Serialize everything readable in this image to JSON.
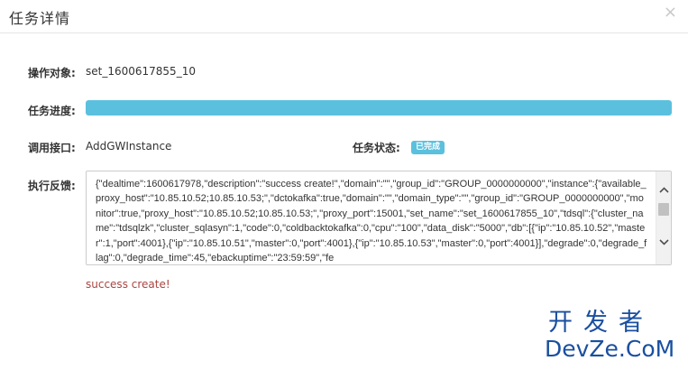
{
  "dialog": {
    "title": "任务详情",
    "close_symbol": "×"
  },
  "fields": {
    "target_label": "操作对象:",
    "target_value": "set_1600617855_10",
    "progress_label": "任务进度:",
    "progress_percent": 100,
    "interface_label": "调用接口:",
    "interface_value": "AddGWInstance",
    "status_label": "任务状态:",
    "status_value": "已完成",
    "feedback_label": "执行反馈:"
  },
  "feedback": {
    "text": "{\"dealtime\":1600617978,\"description\":\"success create!\",\"domain\":\"\",\"group_id\":\"GROUP_0000000000\",\"instance\":{\"available_proxy_host\":\"10.85.10.52;10.85.10.53;\",\"dctokafka\":true,\"domain\":\"\",\"domain_type\":\"\",\"group_id\":\"GROUP_0000000000\",\"monitor\":true,\"proxy_host\":\"10.85.10.52;10.85.10.53;\",\"proxy_port\":15001,\"set_name\":\"set_1600617855_10\",\"tdsql\":{\"cluster_name\":\"tdsqlzk\",\"cluster_sqlasyn\":1,\"code\":0,\"coldbacktokafka\":0,\"cpu\":\"100\",\"data_disk\":\"5000\",\"db\":[{\"ip\":\"10.85.10.52\",\"master\":1,\"port\":4001},{\"ip\":\"10.85.10.51\",\"master\":0,\"port\":4001},{\"ip\":\"10.85.10.53\",\"master\":0,\"port\":4001}],\"degrade\":0,\"degrade_flag\":0,\"degrade_time\":45,\"ebackuptime\":\"23:59:59\",\"fe"
  },
  "result_message": "success create!",
  "watermark": {
    "cn": "开发者",
    "en": "DevZe.CoM"
  },
  "colors": {
    "progress": "#5bc0de",
    "badge": "#5bc0de",
    "error_text": "#a94442",
    "watermark": "#1a4fa0"
  }
}
